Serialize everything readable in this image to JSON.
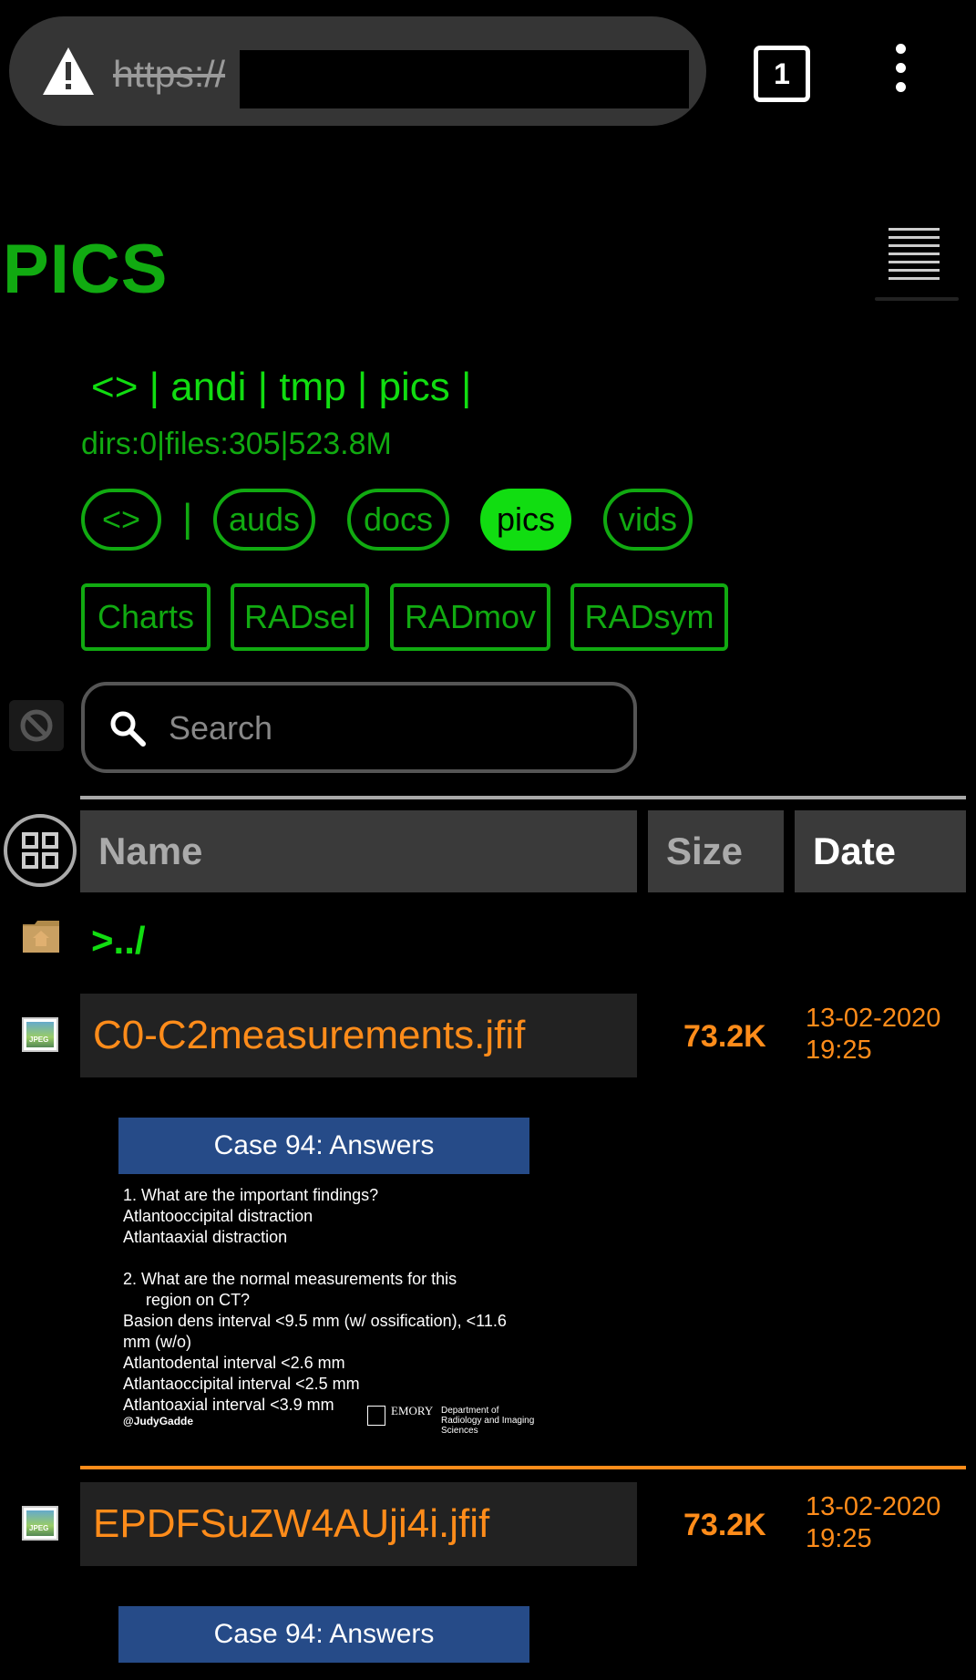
{
  "browser": {
    "url_prefix": "https://",
    "tab_count": "1"
  },
  "page": {
    "title": "PICS",
    "breadcrumb": "<> | andi | tmp | pics |",
    "stats": "dirs:0|files:305|523.8M"
  },
  "nav_pills": [
    {
      "label": "<>"
    },
    {
      "label": "auds"
    },
    {
      "label": "docs"
    },
    {
      "label": "pics",
      "active": true
    },
    {
      "label": "vids"
    }
  ],
  "nav_separator": "|",
  "rad_buttons": [
    "Charts",
    "RADsel",
    "RADmov",
    "RADsym"
  ],
  "search": {
    "placeholder": "Search"
  },
  "table": {
    "headers": {
      "name": "Name",
      "size": "Size",
      "date": "Date"
    },
    "parent_link": ">../",
    "files": [
      {
        "name": "C0-C2measurements.jfif",
        "size": "73.2K",
        "date": "13-02-2020",
        "time": "19:25",
        "thumbnail": {
          "heading": "Case 94: Answers",
          "lines": [
            "1.  What are the important findings?",
            "Atlantooccipital distraction",
            "Atlantaaxial distraction",
            "",
            "2.  What are the normal measurements for this",
            "     region on CT?",
            "Basion dens interval <9.5 mm (w/ ossification), <11.6",
            "mm (w/o)",
            "Atlantodental interval <2.6 mm",
            "Atlantaoccipital interval <2.5 mm",
            "Atlantoaxial interval <3.9 mm"
          ],
          "footer_left": "@JudyGadde",
          "footer_org": "EMORY",
          "footer_dept": "Department of Radiology and Imaging Sciences"
        }
      },
      {
        "name": "EPDFSuZW4AUji4i.jfif",
        "size": "73.2K",
        "date": "13-02-2020",
        "time": "19:25",
        "thumbnail": {
          "heading": "Case 94: Answers"
        }
      }
    ]
  },
  "colors": {
    "green": "#11dd11",
    "dark_green": "#11aa11",
    "orange": "#ff8c1a",
    "header_bg": "#3a3a3a"
  }
}
